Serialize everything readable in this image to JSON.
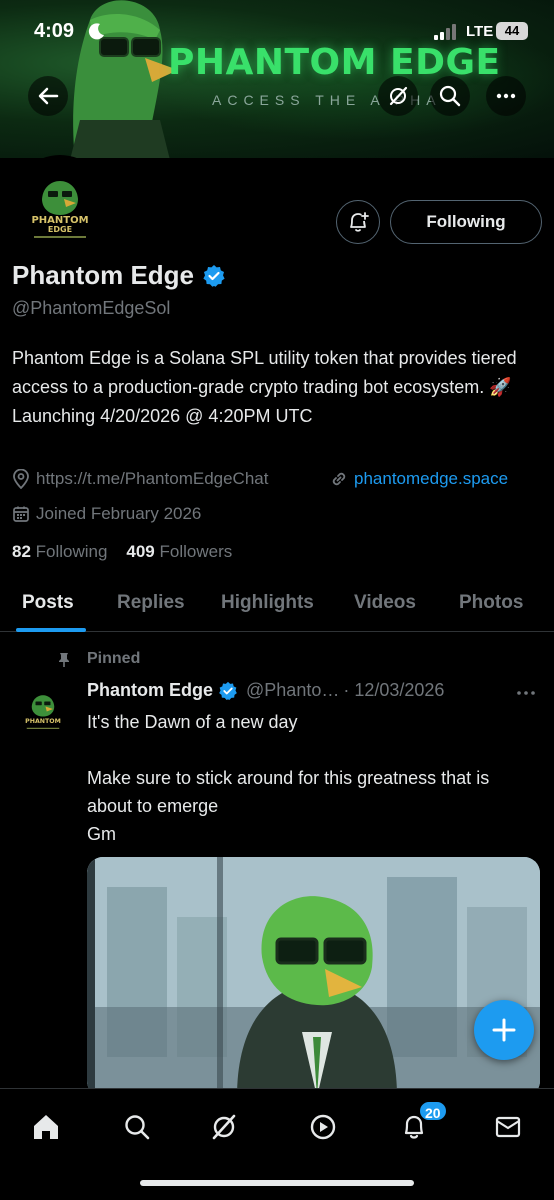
{
  "status_bar": {
    "time": "4:09",
    "network": "LTE",
    "battery": "44"
  },
  "banner": {
    "title": "PHANTOM EDGE",
    "subtitle": "ACCESS THE A  PHA"
  },
  "profile": {
    "name": "Phantom Edge",
    "handle": "@PhantomEdgeSol",
    "follow_button": "Following",
    "bio": "Phantom Edge is a Solana SPL utility token that provides tiered access to a production-grade crypto trading bot ecosystem. 🚀 Launching 4/20/2026 @ 4:20PM UTC",
    "location": "https://t.me/PhantomEdgeChat",
    "website": "phantomedge.space",
    "joined": "Joined February 2026",
    "following_count": "82",
    "following_label": "Following",
    "followers_count": "409",
    "followers_label": "Followers",
    "avatar_text_1": "PHANTOM",
    "avatar_text_2": "EDGE"
  },
  "tabs": [
    {
      "label": "Posts"
    },
    {
      "label": "Replies"
    },
    {
      "label": "Highlights"
    },
    {
      "label": "Videos"
    },
    {
      "label": "Photos"
    }
  ],
  "post": {
    "pinned_label": "Pinned",
    "author": "Phantom Edge",
    "handle": "@Phanto…",
    "date": "· 12/03/2026",
    "text": "It's the Dawn of a new day\n\nMake sure to stick around for this greatness that is about to emerge\nGm"
  },
  "nav": {
    "notifications_badge": "20"
  },
  "colors": {
    "accent": "#1d9bf0",
    "brand_green": "#39e06a",
    "background": "#000000"
  },
  "icons": [
    "back-arrow-icon",
    "grok-icon",
    "search-icon",
    "more-icon",
    "notification-bell-plus-icon",
    "verified-badge-icon",
    "location-icon",
    "link-icon",
    "calendar-icon",
    "pin-icon",
    "home-icon",
    "explore-icon",
    "spaces-icon",
    "notifications-icon",
    "messages-icon",
    "compose-plus-icon"
  ]
}
